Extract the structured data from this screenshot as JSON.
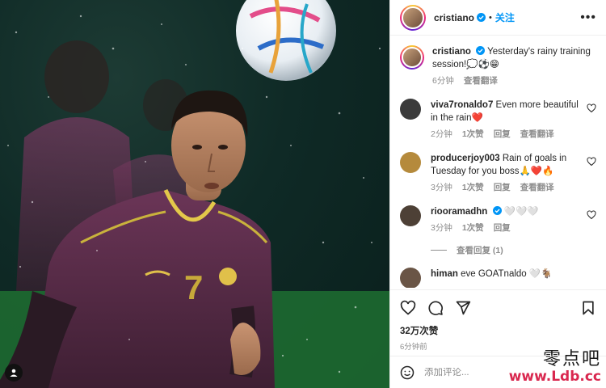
{
  "post": {
    "author": "cristiano",
    "follow_label": "关注",
    "more_icon": "more-options-icon",
    "caption": {
      "username": "cristiano",
      "text": "Yesterday's rainy training session!💭⚽😁",
      "time": "6分钟",
      "translate": "查看翻译"
    }
  },
  "comments": [
    {
      "username": "viva7ronaldo7",
      "text": "Even more beautiful in the rain❤️",
      "time": "2分钟",
      "likes": "1次赞",
      "reply": "回复",
      "translate": "查看翻译",
      "avatar_color": "#3b3b3b"
    },
    {
      "username": "producerjoy003",
      "text": "Rain of goals in Tuesday for you boss🙏❤️🔥",
      "time": "3分钟",
      "likes": "1次赞",
      "reply": "回复",
      "translate": "查看翻译",
      "avatar_color": "#b58a3c"
    },
    {
      "username": "riooramadhn",
      "text": "🤍🤍🤍",
      "time": "3分钟",
      "likes": "1次赞",
      "reply": "回复",
      "verified": true,
      "avatar_color": "#4d4036"
    },
    {
      "username": "himan",
      "text": "eve GOATnaldo 🤍🐐",
      "avatar_color": "#6a5546"
    }
  ],
  "view_replies": "查看回复 (1)",
  "likes_count": "32万次赞",
  "posted_ago": "6分钟前",
  "add_comment": {
    "placeholder": "添加评论...",
    "icon": "emoji-icon"
  },
  "watermark": {
    "line1": "零点吧",
    "line2": "www.Ldb.cc"
  },
  "colors": {
    "accent": "#0095f6",
    "heart": "#ed4956",
    "muted": "#8e8e8e"
  }
}
